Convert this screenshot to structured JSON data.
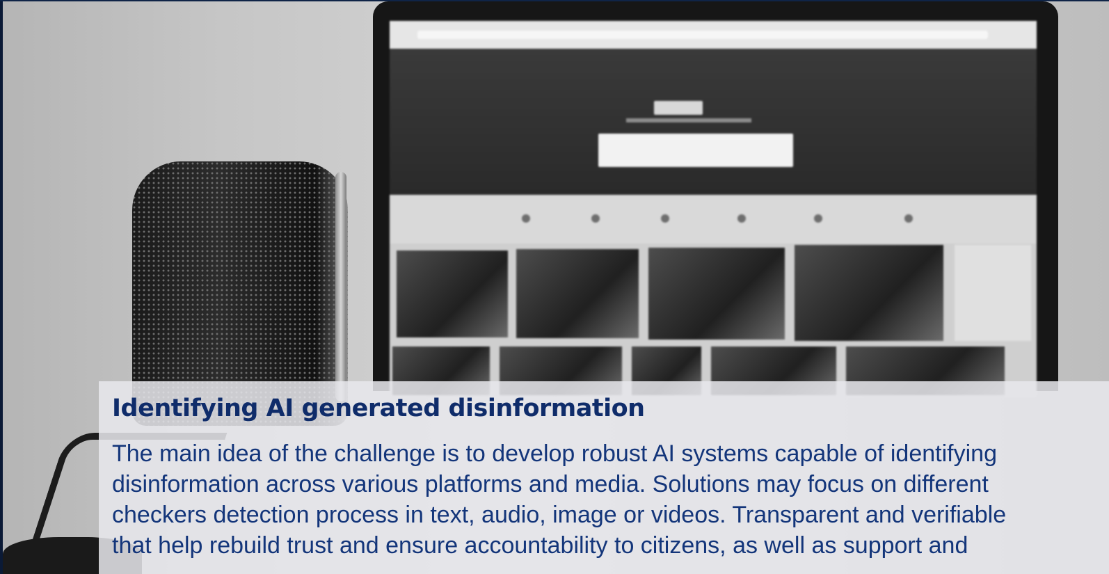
{
  "colors": {
    "accent": "#0f2c6a",
    "body_text": "#13357a",
    "panel_background": "#e8e8ec"
  },
  "hero_image": {
    "description_icon": "photo-microphone-laptop-icon"
  },
  "panel": {
    "title": "Identifying AI generated disinformation",
    "lines": [
      "The main idea of the challenge is to develop robust AI systems capable of identifying",
      "disinformation across various platforms and media. Solutions may focus on different",
      "checkers detection process in text, audio, image or videos. Transparent and verifiable",
      "that help rebuild trust and ensure accountability to citizens, as well as support and"
    ]
  }
}
